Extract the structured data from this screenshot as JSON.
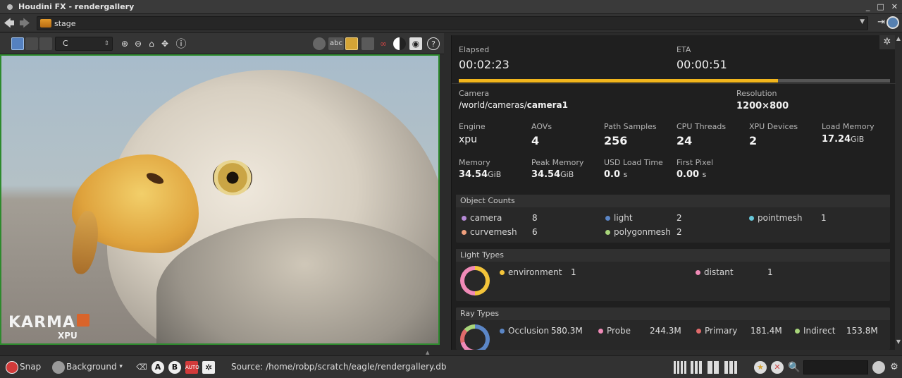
{
  "window": {
    "title": "Houdini FX - rendergallery",
    "controls": [
      "_",
      "□",
      "✕"
    ]
  },
  "pathbar": {
    "back": "🡄",
    "forward": "🡆",
    "path": "stage",
    "dropdown": "▼",
    "pin": "⇥"
  },
  "viewer": {
    "camera": "C",
    "camera_arrow": "⇕",
    "toolbar_glyphs": {
      "zoom_in": "⊕",
      "zoom_out": "⊖",
      "home": "⌂",
      "fit": "✥",
      "info": "ⓘ",
      "abc": "abc",
      "help": "?"
    },
    "logo": "KARMA",
    "logo_sub": "XPU"
  },
  "stats": {
    "elapsed_label": "Elapsed",
    "elapsed": "00:02:23",
    "eta_label": "ETA",
    "eta": "00:00:51",
    "progress": 0.74,
    "camera_label": "Camera",
    "camera_prefix": "/world/cameras/",
    "camera_name": "camera1",
    "resolution_label": "Resolution",
    "resolution": "1200×800",
    "engine_label": "Engine",
    "engine": "xpu",
    "aovs_label": "AOVs",
    "aovs": "4",
    "path_samples_label": "Path Samples",
    "path_samples": "256",
    "cpu_threads_label": "CPU Threads",
    "cpu_threads": "24",
    "xpu_devices_label": "XPU Devices",
    "xpu_devices": "2",
    "load_memory_label": "Load Memory",
    "load_memory": "17.24",
    "load_memory_unit": "GiB",
    "memory_label": "Memory",
    "memory": "34.54",
    "memory_unit": "GiB",
    "peak_memory_label": "Peak Memory",
    "peak_memory": "34.54",
    "peak_memory_unit": "GiB",
    "usd_load_label": "USD Load Time",
    "usd_load": "0.0",
    "usd_load_unit": "s",
    "first_pixel_label": "First Pixel",
    "first_pixel": "0.00",
    "first_pixel_unit": "s",
    "gear": "✲"
  },
  "object_counts": {
    "title": "Object Counts",
    "items": [
      {
        "label": "camera",
        "count": "8",
        "color": "#b58ad6"
      },
      {
        "label": "light",
        "count": "2",
        "color": "#5b86c6"
      },
      {
        "label": "pointmesh",
        "count": "1",
        "color": "#67c7d9"
      },
      {
        "label": "curvemesh",
        "count": "6",
        "color": "#f0a07d"
      },
      {
        "label": "polygonmesh",
        "count": "2",
        "color": "#a8d57a"
      }
    ]
  },
  "light_types": {
    "title": "Light Types",
    "items": [
      {
        "label": "environment",
        "count": "1",
        "color": "#f3c43a"
      },
      {
        "label": "distant",
        "count": "1",
        "color": "#f08ab7"
      }
    ]
  },
  "ray_types": {
    "title": "Ray Types",
    "items": [
      {
        "label": "Occlusion",
        "count": "580.3M",
        "color": "#5b86c6"
      },
      {
        "label": "Probe",
        "count": "244.3M",
        "color": "#f08ab7"
      },
      {
        "label": "Primary",
        "count": "181.4M",
        "color": "#e06b6b"
      },
      {
        "label": "Indirect",
        "count": "153.8M",
        "color": "#a8d57a"
      }
    ]
  },
  "bottombar": {
    "snap": "Snap",
    "background": "Background",
    "background_arrow": "▾",
    "source": "Source: /home/robp/scratch/eagle/rendergallery.db",
    "badges": [
      "A",
      "B",
      "AUTO",
      "✲"
    ],
    "search_icon": "🔍"
  }
}
